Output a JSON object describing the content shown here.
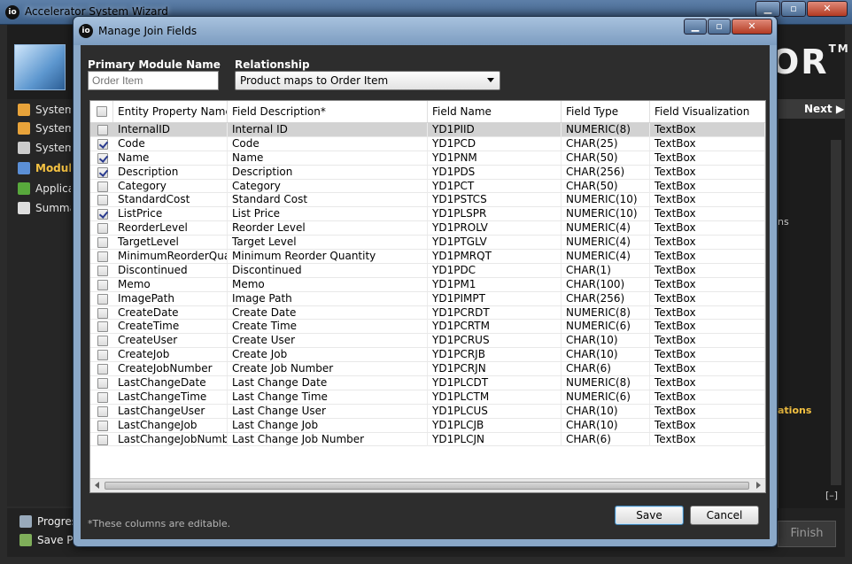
{
  "app": {
    "title": "Accelerator System Wizard",
    "logo_text": "OR",
    "logo_mark": "TM",
    "app_icon": "io",
    "sidebar": [
      {
        "label": "System",
        "color": "#e8a33a"
      },
      {
        "label": "System",
        "color": "#e8a33a"
      },
      {
        "label": "System",
        "color": "#cccccc"
      },
      {
        "label": "Modules",
        "color": "#5b8fd6",
        "active": true
      },
      {
        "label": "Applications",
        "color": "#58a83c"
      },
      {
        "label": "Summary",
        "color": "#dddddd"
      }
    ],
    "next_label": "Next ▶",
    "right_text_1": "ns",
    "right_text_2": "ations",
    "collapse_label": "[–]",
    "progress_label": "Progress",
    "save_progress_label": "Save Progress",
    "finish_label": "Finish"
  },
  "dialog": {
    "title": "Manage Join Fields",
    "primary_module_label": "Primary Module Name",
    "primary_module_placeholder": "Order Item",
    "relationship_label": "Relationship",
    "relationship_value": "Product maps to Order Item",
    "columns": [
      "Entity Property Name*",
      "Field Description*",
      "Field Name",
      "Field Type",
      "Field Visualization"
    ],
    "rows": [
      {
        "checked": false,
        "name": "InternalID",
        "desc": "Internal ID",
        "field": "YD1PIID",
        "type": "NUMERIC(8)",
        "vis": "TextBox",
        "selected": true
      },
      {
        "checked": true,
        "name": "Code",
        "desc": "Code",
        "field": "YD1PCD",
        "type": "CHAR(25)",
        "vis": "TextBox"
      },
      {
        "checked": true,
        "name": "Name",
        "desc": "Name",
        "field": "YD1PNM",
        "type": "CHAR(50)",
        "vis": "TextBox"
      },
      {
        "checked": true,
        "name": "Description",
        "desc": "Description",
        "field": "YD1PDS",
        "type": "CHAR(256)",
        "vis": "TextBox"
      },
      {
        "checked": false,
        "name": "Category",
        "desc": "Category",
        "field": "YD1PCT",
        "type": "CHAR(50)",
        "vis": "TextBox"
      },
      {
        "checked": false,
        "name": "StandardCost",
        "desc": "Standard Cost",
        "field": "YD1PSTCS",
        "type": "NUMERIC(10)",
        "vis": "TextBox"
      },
      {
        "checked": true,
        "name": "ListPrice",
        "desc": "List Price",
        "field": "YD1PLSPR",
        "type": "NUMERIC(10)",
        "vis": "TextBox"
      },
      {
        "checked": false,
        "name": "ReorderLevel",
        "desc": "Reorder Level",
        "field": "YD1PROLV",
        "type": "NUMERIC(4)",
        "vis": "TextBox"
      },
      {
        "checked": false,
        "name": "TargetLevel",
        "desc": "Target Level",
        "field": "YD1PTGLV",
        "type": "NUMERIC(4)",
        "vis": "TextBox"
      },
      {
        "checked": false,
        "name": "MinimumReorderQuan",
        "desc": "Minimum Reorder Quantity",
        "field": "YD1PMRQT",
        "type": "NUMERIC(4)",
        "vis": "TextBox"
      },
      {
        "checked": false,
        "name": "Discontinued",
        "desc": "Discontinued",
        "field": "YD1PDC",
        "type": "CHAR(1)",
        "vis": "TextBox"
      },
      {
        "checked": false,
        "name": "Memo",
        "desc": "Memo",
        "field": "YD1PM1",
        "type": "CHAR(100)",
        "vis": "TextBox"
      },
      {
        "checked": false,
        "name": "ImagePath",
        "desc": "Image Path",
        "field": "YD1PIMPT",
        "type": "CHAR(256)",
        "vis": "TextBox"
      },
      {
        "checked": false,
        "name": "CreateDate",
        "desc": "Create Date",
        "field": "YD1PCRDT",
        "type": "NUMERIC(8)",
        "vis": "TextBox"
      },
      {
        "checked": false,
        "name": "CreateTime",
        "desc": "Create Time",
        "field": "YD1PCRTM",
        "type": "NUMERIC(6)",
        "vis": "TextBox"
      },
      {
        "checked": false,
        "name": "CreateUser",
        "desc": "Create User",
        "field": "YD1PCRUS",
        "type": "CHAR(10)",
        "vis": "TextBox"
      },
      {
        "checked": false,
        "name": "CreateJob",
        "desc": "Create Job",
        "field": "YD1PCRJB",
        "type": "CHAR(10)",
        "vis": "TextBox"
      },
      {
        "checked": false,
        "name": "CreateJobNumber",
        "desc": "Create Job Number",
        "field": "YD1PCRJN",
        "type": "CHAR(6)",
        "vis": "TextBox"
      },
      {
        "checked": false,
        "name": "LastChangeDate",
        "desc": "Last Change Date",
        "field": "YD1PLCDT",
        "type": "NUMERIC(8)",
        "vis": "TextBox"
      },
      {
        "checked": false,
        "name": "LastChangeTime",
        "desc": "Last Change Time",
        "field": "YD1PLCTM",
        "type": "NUMERIC(6)",
        "vis": "TextBox"
      },
      {
        "checked": false,
        "name": "LastChangeUser",
        "desc": "Last Change User",
        "field": "YD1PLCUS",
        "type": "CHAR(10)",
        "vis": "TextBox"
      },
      {
        "checked": false,
        "name": "LastChangeJob",
        "desc": "Last Change Job",
        "field": "YD1PLCJB",
        "type": "CHAR(10)",
        "vis": "TextBox"
      },
      {
        "checked": false,
        "name": "LastChangeJobNumber",
        "desc": "Last Change Job Number",
        "field": "YD1PLCJN",
        "type": "CHAR(6)",
        "vis": "TextBox"
      }
    ],
    "footnote": "*These columns are editable.",
    "save_label": "Save",
    "cancel_label": "Cancel"
  }
}
